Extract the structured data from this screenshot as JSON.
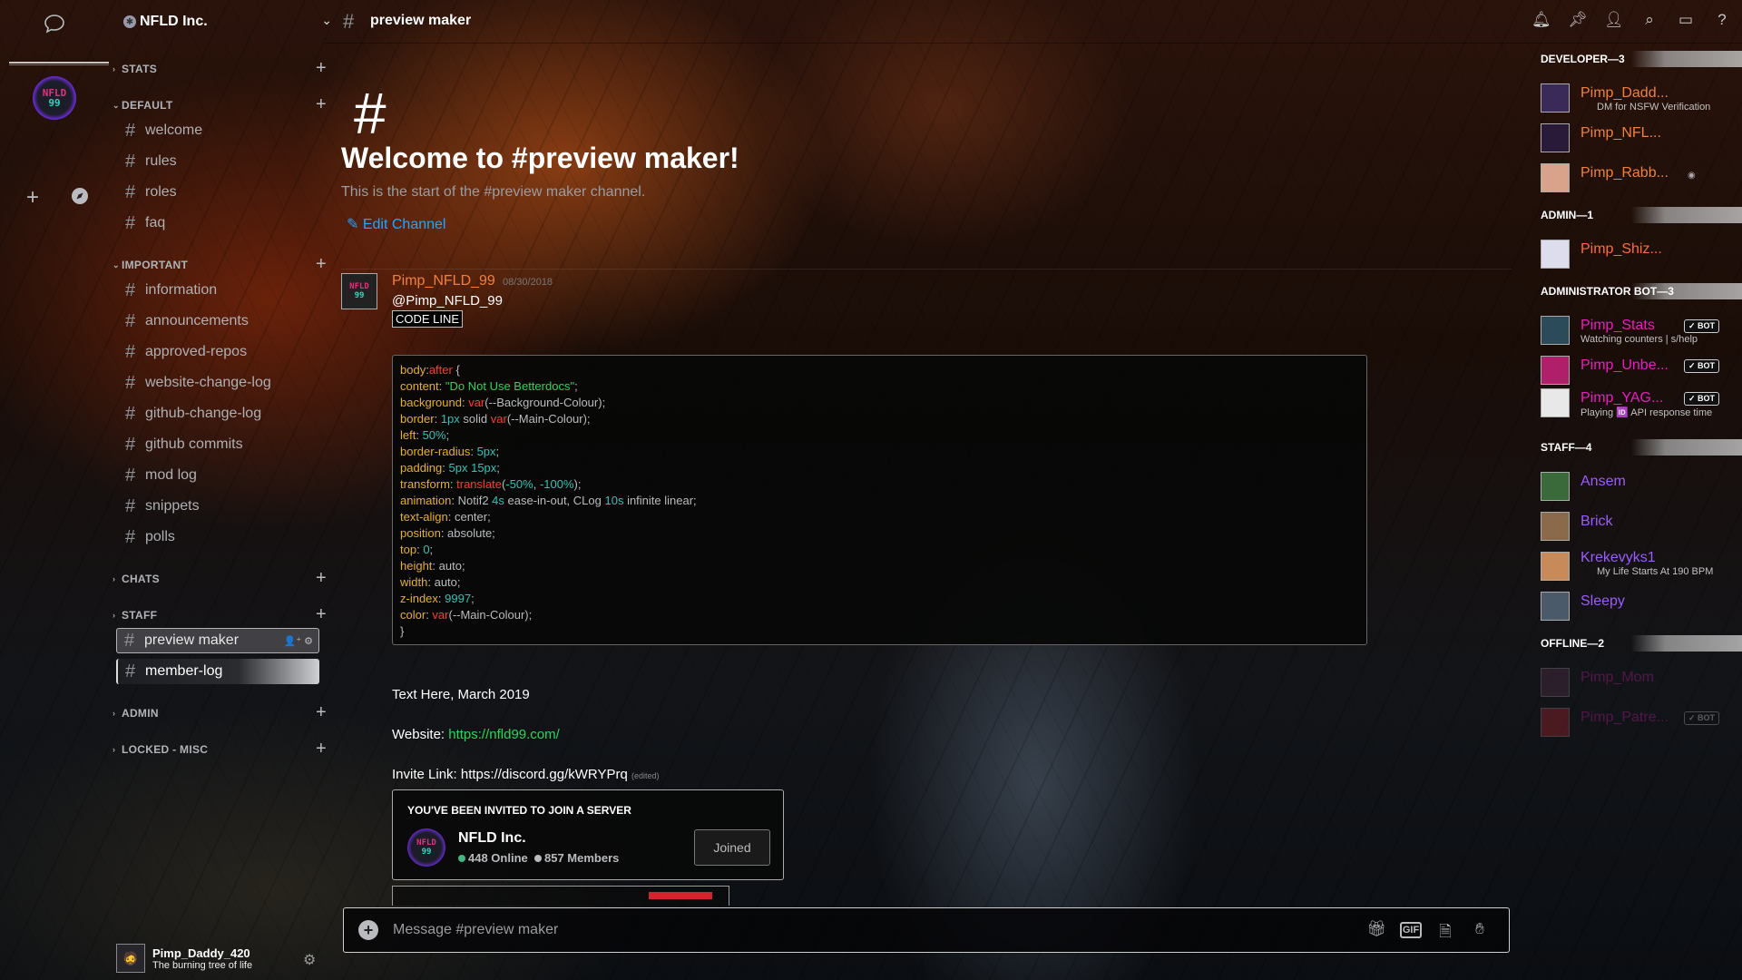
{
  "guild_rail": {
    "server_avatar_line1": "NFLD",
    "server_avatar_line2": "99",
    "add_label": "+",
    "explore_label": "✧"
  },
  "sidebar": {
    "server_name": "NFLD Inc.",
    "categories": [
      {
        "name": "STATS"
      },
      {
        "name": "DEFAULT"
      },
      {
        "name": "IMPORTANT"
      },
      {
        "name": "CHATS"
      },
      {
        "name": "STAFF"
      },
      {
        "name": "ADMIN"
      },
      {
        "name": "LOCKED - MISC"
      }
    ],
    "default_channels": [
      "welcome",
      "rules",
      "roles",
      "faq"
    ],
    "important_channels": [
      "information",
      "announcements",
      "approved-repos",
      "website-change-log",
      "github-change-log",
      "github commits",
      "mod log",
      "snippets",
      "polls"
    ],
    "staff_channels": [
      "preview maker",
      "member-log"
    ],
    "user": {
      "name": "Pimp_Daddy_420",
      "status": "The burning tree of life"
    }
  },
  "topbar": {
    "channel_name": "preview maker"
  },
  "chat": {
    "welcome_title": "Welcome to #preview maker!",
    "welcome_subtitle": "This is the start of the #preview maker channel.",
    "edit_channel": "Edit Channel",
    "message": {
      "author": "Pimp_NFLD_99",
      "timestamp": "08/30/2018",
      "mention": "@Pimp_NFLD_99",
      "code_label": "CODE LINE",
      "text_here": "Text Here, March 2019",
      "website_label": "Website: ",
      "website_url": "https://nfld99.com/",
      "invite_link_label": "Invite Link: https://discord.gg/kWRYPrq",
      "edited": "(edited)"
    },
    "invite": {
      "label": "YOU'VE BEEN INVITED TO JOIN A SERVER",
      "server_name": "NFLD Inc.",
      "online": "448 Online",
      "members": "857 Members",
      "button": "Joined",
      "online_color": "#43b581",
      "members_color": "#b9bbbe"
    },
    "composer_placeholder": "Message #preview maker"
  },
  "members": {
    "groups": [
      {
        "title": "DEVELOPER—3"
      },
      {
        "title": "ADMIN—1"
      },
      {
        "title": "ADMINISTRATOR BOT—3"
      },
      {
        "title": "STAFF—4"
      },
      {
        "title": "OFFLINE—2"
      }
    ],
    "list": [
      {
        "name": "Pimp_Dadd...",
        "status": "DM for NSFW Verification",
        "color": "#f0803c"
      },
      {
        "name": "Pimp_NFL...",
        "status": "",
        "color": "#f0803c"
      },
      {
        "name": "Pimp_Rabb...",
        "status": "",
        "color": "#f0803c"
      },
      {
        "name": "Pimp_Shiz...",
        "status": "",
        "color": "#ff6a3c"
      },
      {
        "name": "Pimp_Stats",
        "status": "Watching counters | s/help",
        "color": "#e91ec0",
        "bot": "✓ BOT"
      },
      {
        "name": "Pimp_Unbe...",
        "status": "",
        "color": "#e91ec0",
        "bot": "✓ BOT"
      },
      {
        "name": "Pimp_YAG...",
        "status": "Playing 🆔 API response time",
        "color": "#e91ec0",
        "bot": "✓ BOT"
      },
      {
        "name": "Ansem",
        "status": "",
        "color": "#9b5cff"
      },
      {
        "name": "Brick",
        "status": "",
        "color": "#9b5cff"
      },
      {
        "name": "Krekevyks1",
        "status": "My Life Starts At 190 BPM",
        "color": "#9b5cff"
      },
      {
        "name": "Sleepy",
        "status": "",
        "color": "#9b5cff"
      },
      {
        "name": "Pimp_Mom",
        "status": "",
        "color": "#e91ec0"
      },
      {
        "name": "Pimp_Patre...",
        "status": "",
        "color": "#e91ec0",
        "bot": "✓ BOT"
      }
    ]
  },
  "colors": {
    "accent_link": "#1ea7ff",
    "author": "#f0803c",
    "code_property": "#e6b122",
    "code_string": "#2cd55a",
    "code_number": "#2ec4b6",
    "code_function": "#ff3b2f"
  }
}
